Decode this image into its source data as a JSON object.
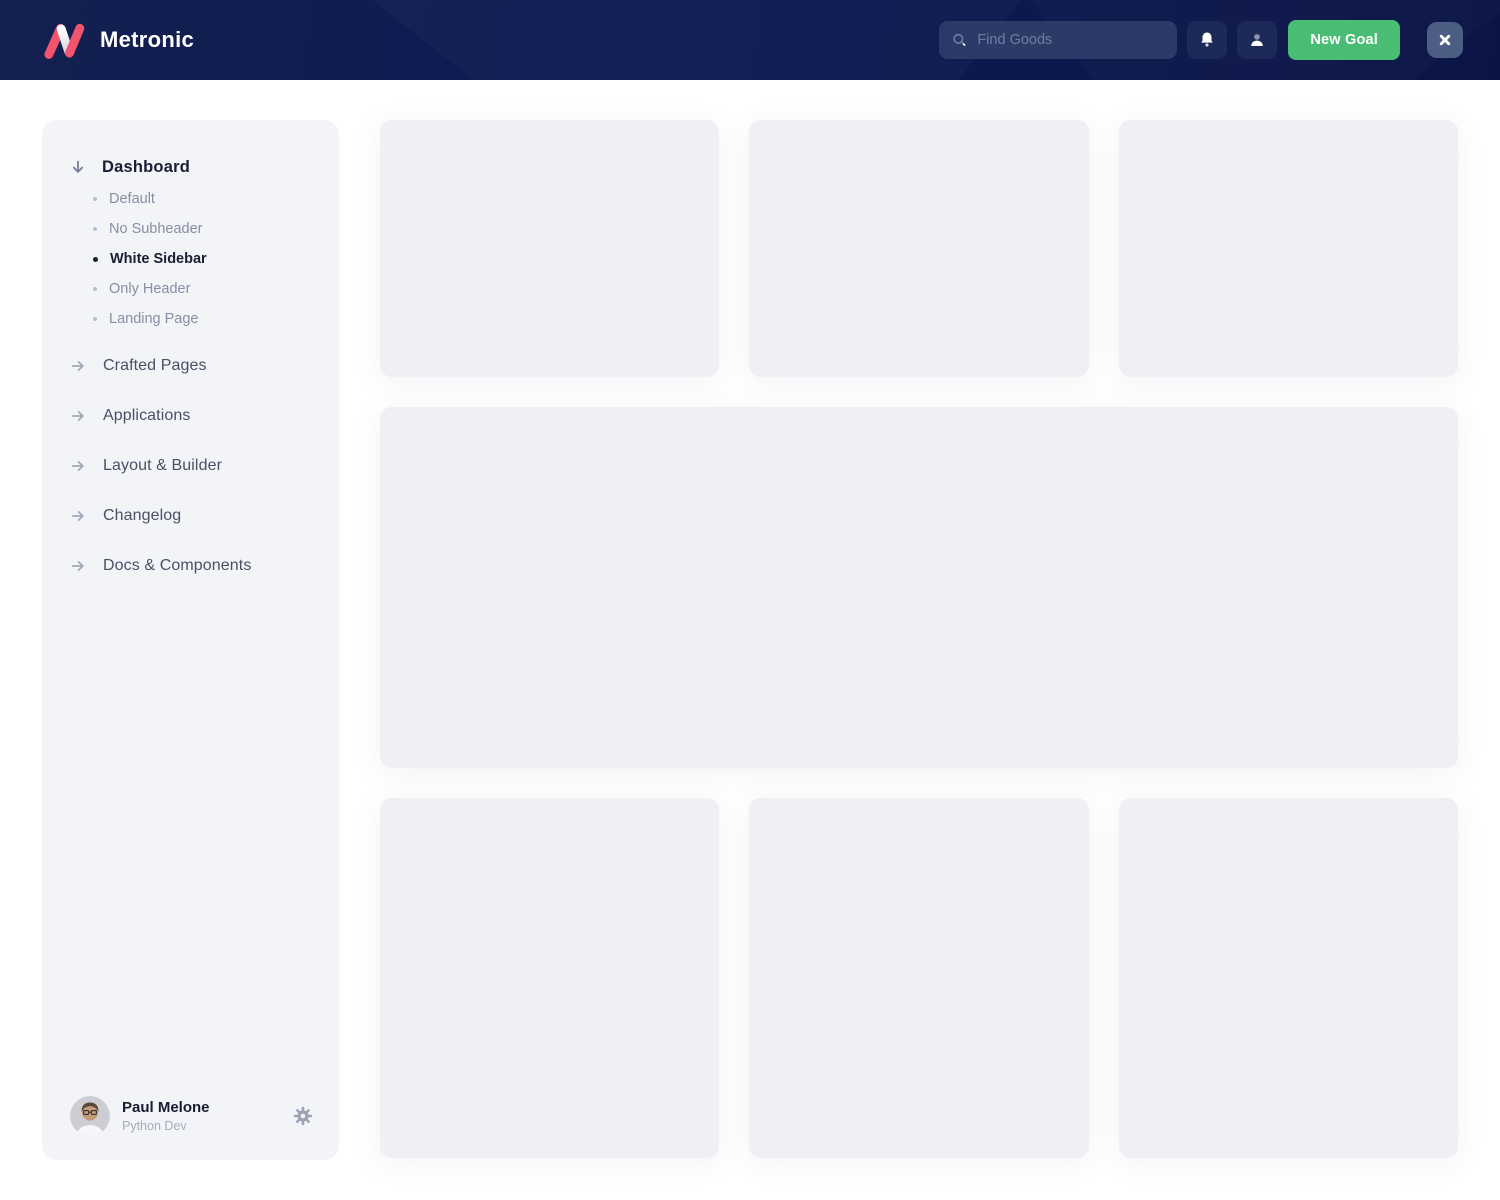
{
  "header": {
    "brand_name": "Metronic",
    "search_placeholder": "Find Goods",
    "new_goal_button": "New Goal",
    "icons": {
      "logo": "metronic-m-logo",
      "search": "magnifier-icon",
      "notifications": "bell-icon",
      "account": "user-icon",
      "close": "x-icon"
    },
    "colors": {
      "header_bg": "#0E1A52",
      "accent_green": "#4ABD74",
      "brand_red": "#F1546C",
      "search_bg": "#2C3A67",
      "icon_button_bg": "#1D2A58",
      "close_button_bg": "#4D5E85"
    }
  },
  "sidebar": {
    "dashboard_section": {
      "label": "Dashboard",
      "icon": "arrow-down-icon",
      "children": [
        {
          "label": "Default",
          "active": false
        },
        {
          "label": "No Subheader",
          "active": false
        },
        {
          "label": "White Sidebar",
          "active": true
        },
        {
          "label": "Only Header",
          "active": false
        },
        {
          "label": "Landing Page",
          "active": false
        }
      ]
    },
    "menu_items": [
      {
        "label": "Crafted Pages",
        "icon": "arrow-right-icon"
      },
      {
        "label": "Applications",
        "icon": "arrow-right-icon"
      },
      {
        "label": "Layout & Builder",
        "icon": "arrow-right-icon"
      },
      {
        "label": "Changelog",
        "icon": "arrow-right-icon"
      },
      {
        "label": "Docs & Components",
        "icon": "arrow-right-icon"
      }
    ],
    "user": {
      "name": "Paul Melone",
      "role": "Python Dev",
      "settings_icon": "gear-icon"
    },
    "colors": {
      "sidebar_bg": "#F3F4F8",
      "active_text": "#1A1E33",
      "muted_text": "#8A8EA3"
    }
  },
  "main": {
    "placeholder_cards": {
      "top_row": 3,
      "middle_row": 1,
      "bottom_row": 3
    },
    "card_color": "#F0F0F4"
  }
}
